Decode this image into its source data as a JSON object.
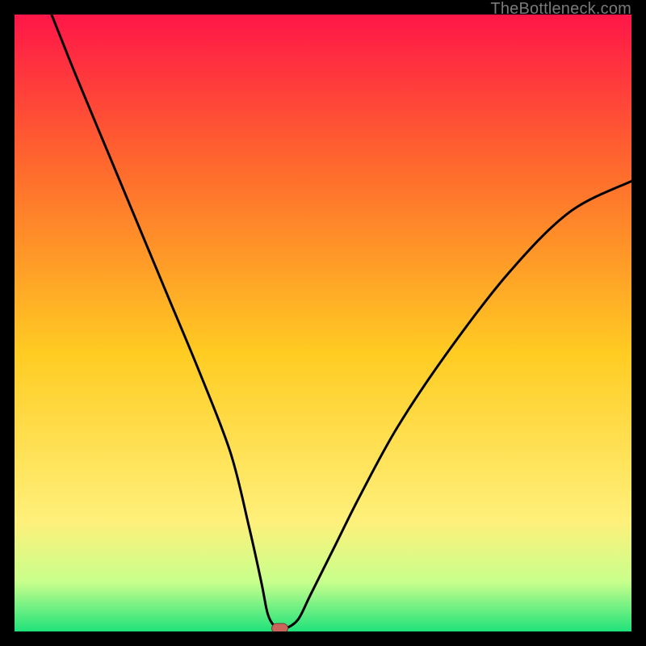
{
  "watermark": "TheBottleneck.com",
  "colors": {
    "bg_black": "#000000",
    "grad_top": "#ff1648",
    "grad_upper_mid": "#ff6a2d",
    "grad_mid": "#ffcc22",
    "grad_lower_mid": "#fff07a",
    "grad_low": "#c8ff8c",
    "grad_bottom": "#1fe27a",
    "curve": "#000000",
    "marker_fill": "#c9655b",
    "marker_stroke": "#7a3c37"
  },
  "chart_data": {
    "type": "line",
    "title": "",
    "xlabel": "",
    "ylabel": "",
    "xlim": [
      0,
      100
    ],
    "ylim": [
      0,
      100
    ],
    "grid": false,
    "legend": false,
    "series": [
      {
        "name": "bottleneck-curve",
        "x": [
          6,
          10,
          15,
          20,
          25,
          30,
          35,
          38,
          40,
          41,
          42,
          43,
          44,
          46,
          48,
          52,
          56,
          62,
          70,
          80,
          90,
          100
        ],
        "y": [
          100,
          90,
          78,
          66,
          54,
          42,
          29,
          17,
          8,
          3,
          1,
          0.5,
          0.5,
          2,
          6,
          14,
          22,
          33,
          45,
          58,
          68,
          73
        ]
      }
    ],
    "marker": {
      "name": "optimal-point",
      "x": 43,
      "y": 0.5
    },
    "background_gradient_stops": [
      {
        "offset": 0.0,
        "color": "#ff1648"
      },
      {
        "offset": 0.25,
        "color": "#ff6a2d"
      },
      {
        "offset": 0.55,
        "color": "#ffcc22"
      },
      {
        "offset": 0.82,
        "color": "#fff07a"
      },
      {
        "offset": 0.92,
        "color": "#c8ff8c"
      },
      {
        "offset": 1.0,
        "color": "#1fe27a"
      }
    ]
  }
}
